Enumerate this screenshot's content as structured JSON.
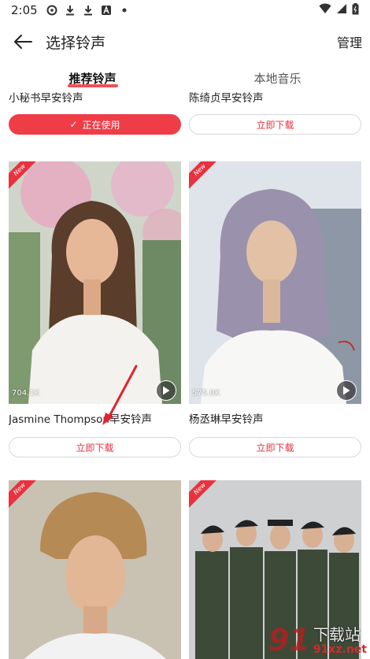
{
  "status_bar": {
    "time": "2:05"
  },
  "header": {
    "title": "选择铃声",
    "manage_label": "管理"
  },
  "tabs": [
    {
      "label": "推荐铃声",
      "active": true
    },
    {
      "label": "本地音乐",
      "active": false
    }
  ],
  "ringtones": [
    {
      "title": "小秘书早安铃声",
      "button": "正在使用",
      "in_use": true
    },
    {
      "title": "陈绮贞早安铃声",
      "button": "立即下载",
      "in_use": false
    },
    {
      "title": "Jasmine Thompson早安铃声",
      "plays": "704.1K",
      "button": "立即下载",
      "badge": "New"
    },
    {
      "title": "杨丞琳早安铃声",
      "plays": "575.0K",
      "button": "立即下载",
      "badge": "New"
    },
    {
      "badge": "New"
    },
    {
      "badge": "New"
    }
  ],
  "watermark": {
    "site": "91xz.net",
    "logo": "91"
  },
  "colors": {
    "accent": "#e8323e",
    "button_border": "#d9d9d9"
  }
}
